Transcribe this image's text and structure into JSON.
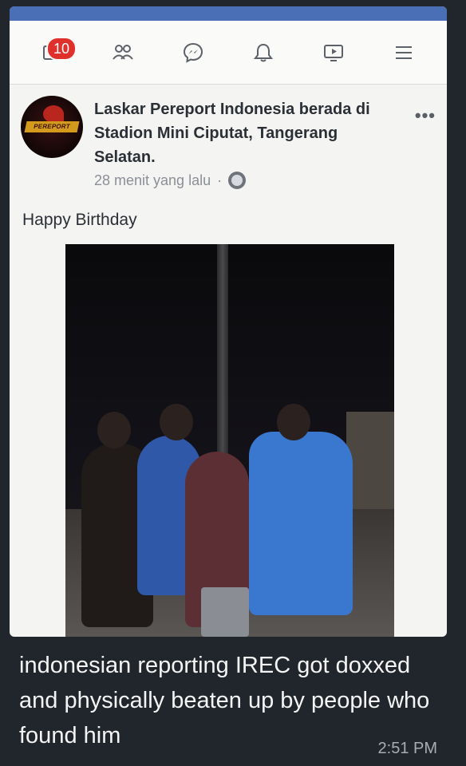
{
  "navbar": {
    "notification_count": "10",
    "icons": [
      "feed-icon",
      "friends-icon",
      "messenger-icon",
      "bell-icon",
      "watch-icon",
      "menu-icon"
    ]
  },
  "post": {
    "page_name_line": "Laskar Pereport Indonesia berada di Stadion Mini Ciputat, Tangerang Selatan.",
    "timestamp": "28 menit yang lalu",
    "separator": "·",
    "caption": "Happy Birthday",
    "avatar_logo_text": "PEREPORT",
    "more_glyph": "•••"
  },
  "message": {
    "text": "indonesian reporting IREC got doxxed and physically beaten up by people who found him",
    "time": "2:51 PM"
  },
  "colors": {
    "chat_background": "#20262b",
    "facebook_blue": "#4a6fb6",
    "badge_red": "#e0302b"
  }
}
